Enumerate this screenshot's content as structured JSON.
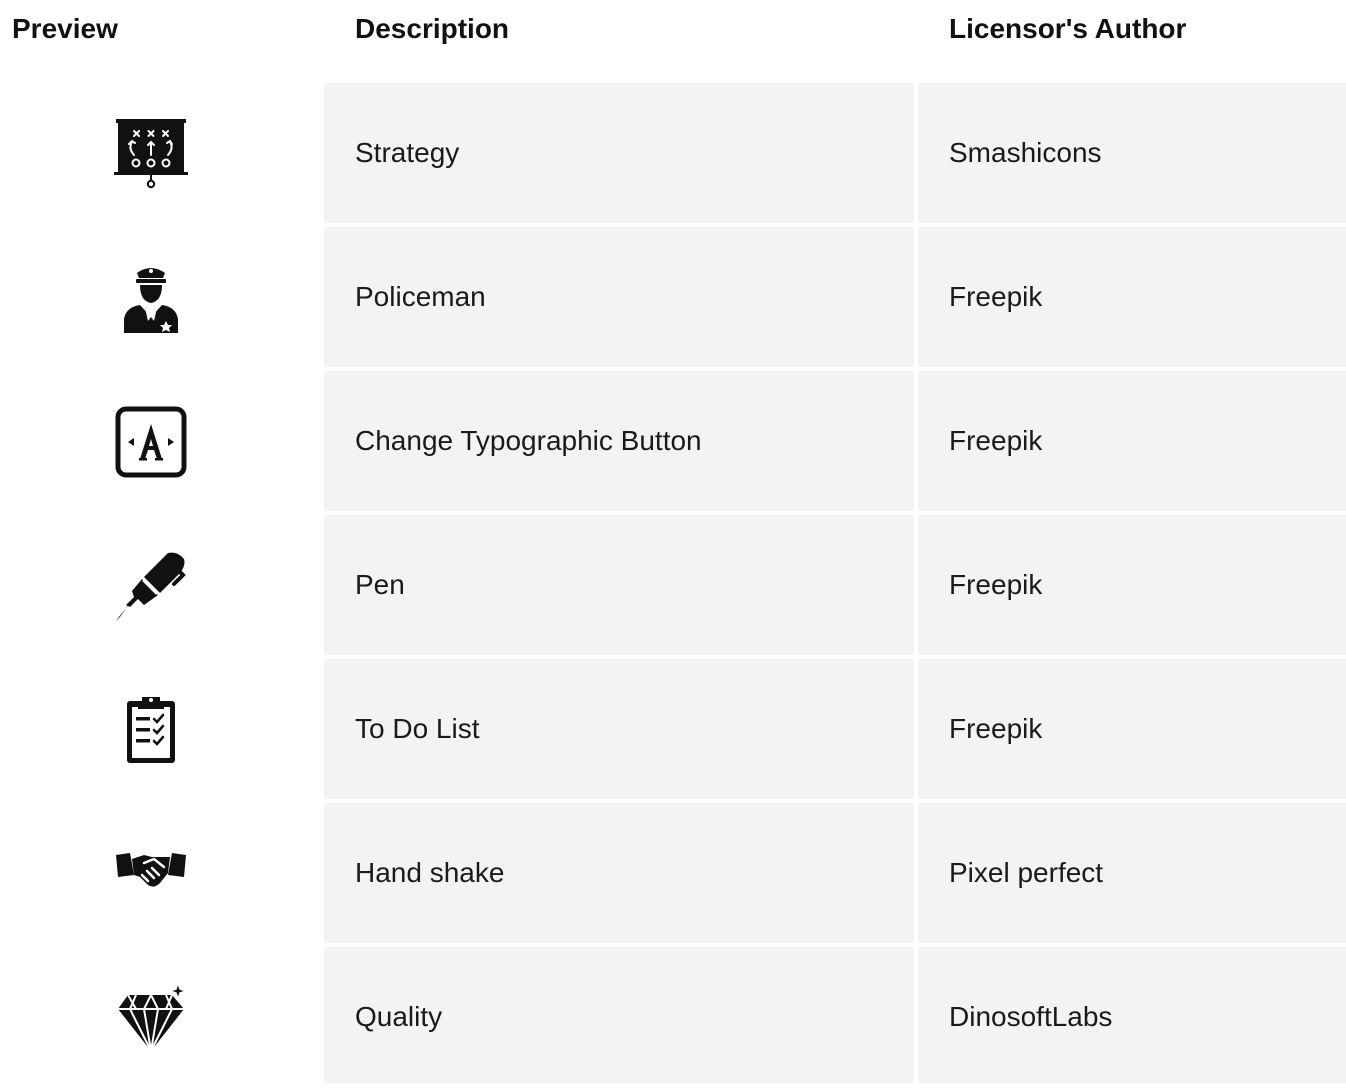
{
  "header": {
    "preview": "Preview",
    "description": "Description",
    "author": "Licensor's Author"
  },
  "rows": [
    {
      "icon": "strategy-board-icon",
      "description": "Strategy",
      "author": "Smashicons"
    },
    {
      "icon": "policeman-icon",
      "description": "Policeman",
      "author": "Freepik"
    },
    {
      "icon": "change-typographic-button-icon",
      "description": "Change Typographic Button",
      "author": "Freepik"
    },
    {
      "icon": "pen-icon",
      "description": "Pen",
      "author": "Freepik"
    },
    {
      "icon": "to-do-list-icon",
      "description": "To Do List",
      "author": "Freepik"
    },
    {
      "icon": "hand-shake-icon",
      "description": "Hand shake",
      "author": "Pixel perfect"
    },
    {
      "icon": "quality-diamond-icon",
      "description": "Quality",
      "author": "DinosoftLabs"
    }
  ],
  "colors": {
    "cell_background": "#f3f3f3",
    "text": "#1a1a1a",
    "icon": "#111111"
  }
}
